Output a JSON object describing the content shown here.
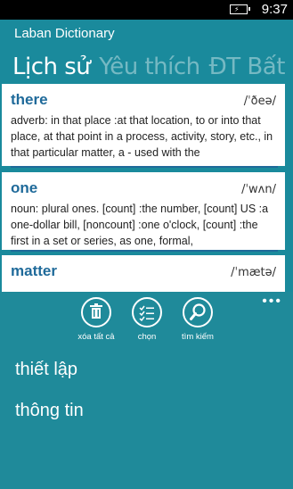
{
  "status": {
    "time": "9:37"
  },
  "app": {
    "title": "Laban Dictionary"
  },
  "pivot": {
    "items": [
      "Lịch sử",
      "Yêu thích",
      "ĐT Bất q"
    ]
  },
  "entries": [
    {
      "word": "there",
      "pronunciation": "/ˈðeə/",
      "definition": "adverb: in that place :at that location, to or into that place, at that point in a process, activity, story, etc., in that particular matter, a - used with the"
    },
    {
      "word": "one",
      "pronunciation": "/ˈwʌn/",
      "definition": "noun: plural ones. [count] :the number, [count] US :a one-dollar bill, [noncount] :one o'clock, [count] :the first in a set or series, as one, formal,"
    },
    {
      "word": "matter",
      "pronunciation": "/ˈmætə/",
      "definition": ""
    }
  ],
  "appbar": {
    "buttons": [
      {
        "label": "xóa tất cả",
        "icon": "trash-icon"
      },
      {
        "label": "chọn",
        "icon": "select-list-icon"
      },
      {
        "label": "tìm kiếm",
        "icon": "search-icon"
      }
    ],
    "more": "•••"
  },
  "menu": {
    "items": [
      "thiết lập",
      "thông tin"
    ]
  }
}
